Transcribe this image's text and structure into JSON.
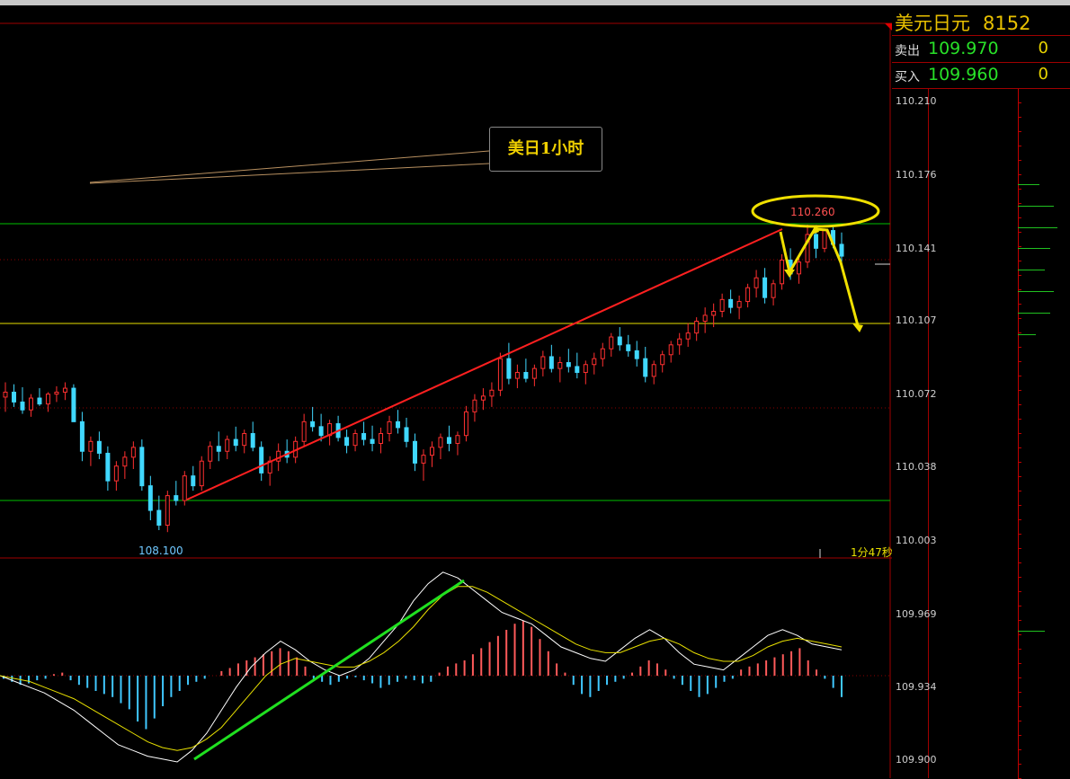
{
  "panel": {
    "title": "美元日元",
    "code": "8152",
    "sell_label": "卖出",
    "sell_price": "109.970",
    "sell_qty": "0",
    "buy_label": "买入",
    "buy_price": "109.960",
    "buy_qty": "0"
  },
  "annotation": {
    "callout": "美日1小时",
    "peak_label": "110.260",
    "low_label": "108.100",
    "timer": "1分47秒"
  },
  "colors": {
    "up": "#ff3030",
    "down": "#40d8ff",
    "trend_up": "#ff2020",
    "trend_macd": "#20e020",
    "ellipse": "#f0e000",
    "support": "#00c000",
    "midline": "#e8e000"
  },
  "chart_data": {
    "type": "candlestick",
    "instrument": "USDJPY 1H",
    "yticks": [
      "110.210",
      "110.176",
      "110.141",
      "110.107",
      "110.072",
      "110.038",
      "110.003",
      "109.969",
      "109.934",
      "109.900"
    ],
    "ohlc": [
      [
        110.085,
        110.1,
        110.07,
        110.09
      ],
      [
        110.09,
        110.098,
        110.075,
        110.08
      ],
      [
        110.08,
        110.095,
        110.068,
        110.072
      ],
      [
        110.072,
        110.088,
        110.065,
        110.084
      ],
      [
        110.084,
        110.094,
        110.076,
        110.078
      ],
      [
        110.078,
        110.09,
        110.07,
        110.088
      ],
      [
        110.088,
        110.096,
        110.08,
        110.09
      ],
      [
        110.09,
        110.1,
        110.082,
        110.094
      ],
      [
        110.094,
        110.098,
        110.06,
        110.06
      ],
      [
        110.06,
        110.07,
        110.02,
        110.03
      ],
      [
        110.03,
        110.045,
        110.015,
        110.04
      ],
      [
        110.04,
        110.05,
        110.022,
        110.028
      ],
      [
        110.028,
        110.035,
        109.99,
        110.0
      ],
      [
        110.0,
        110.02,
        109.99,
        110.015
      ],
      [
        110.015,
        110.03,
        110.002,
        110.024
      ],
      [
        110.024,
        110.04,
        110.012,
        110.034
      ],
      [
        110.034,
        110.042,
        109.99,
        109.995
      ],
      [
        109.995,
        110.005,
        109.96,
        109.97
      ],
      [
        109.97,
        109.985,
        109.95,
        109.955
      ],
      [
        109.955,
        109.99,
        109.948,
        109.985
      ],
      [
        109.985,
        110.0,
        109.975,
        109.98
      ],
      [
        109.98,
        110.01,
        109.975,
        110.005
      ],
      [
        110.005,
        110.015,
        109.99,
        109.995
      ],
      [
        109.995,
        110.025,
        109.99,
        110.02
      ],
      [
        110.02,
        110.04,
        110.012,
        110.035
      ],
      [
        110.035,
        110.05,
        110.02,
        110.03
      ],
      [
        110.03,
        110.046,
        110.022,
        110.042
      ],
      [
        110.042,
        110.055,
        110.03,
        110.036
      ],
      [
        110.036,
        110.052,
        110.028,
        110.048
      ],
      [
        110.048,
        110.06,
        110.03,
        110.034
      ],
      [
        110.034,
        110.04,
        110.0,
        110.008
      ],
      [
        110.008,
        110.025,
        109.995,
        110.02
      ],
      [
        110.02,
        110.038,
        110.01,
        110.03
      ],
      [
        110.03,
        110.042,
        110.018,
        110.024
      ],
      [
        110.024,
        110.045,
        110.018,
        110.04
      ],
      [
        110.04,
        110.068,
        110.035,
        110.06
      ],
      [
        110.06,
        110.075,
        110.05,
        110.055
      ],
      [
        110.055,
        110.068,
        110.04,
        110.046
      ],
      [
        110.046,
        110.062,
        110.036,
        110.058
      ],
      [
        110.058,
        110.066,
        110.04,
        110.044
      ],
      [
        110.044,
        110.052,
        110.028,
        110.036
      ],
      [
        110.036,
        110.052,
        110.03,
        110.048
      ],
      [
        110.048,
        110.06,
        110.036,
        110.042
      ],
      [
        110.042,
        110.056,
        110.03,
        110.038
      ],
      [
        110.038,
        110.054,
        110.028,
        110.048
      ],
      [
        110.048,
        110.066,
        110.04,
        110.06
      ],
      [
        110.06,
        110.072,
        110.048,
        110.054
      ],
      [
        110.054,
        110.064,
        110.034,
        110.04
      ],
      [
        110.04,
        110.048,
        110.01,
        110.018
      ],
      [
        110.018,
        110.032,
        110.0,
        110.026
      ],
      [
        110.026,
        110.04,
        110.014,
        110.034
      ],
      [
        110.034,
        110.048,
        110.022,
        110.044
      ],
      [
        110.044,
        110.056,
        110.03,
        110.038
      ],
      [
        110.038,
        110.05,
        110.026,
        110.046
      ],
      [
        110.046,
        110.076,
        110.04,
        110.07
      ],
      [
        110.07,
        110.088,
        110.06,
        110.082
      ],
      [
        110.082,
        110.094,
        110.072,
        110.086
      ],
      [
        110.086,
        110.1,
        110.075,
        110.092
      ],
      [
        110.092,
        110.13,
        110.086,
        110.124
      ],
      [
        110.124,
        110.14,
        110.098,
        110.104
      ],
      [
        110.104,
        110.118,
        110.094,
        110.11
      ],
      [
        110.11,
        110.124,
        110.1,
        110.104
      ],
      [
        110.104,
        110.118,
        110.096,
        110.114
      ],
      [
        110.114,
        110.132,
        110.106,
        110.126
      ],
      [
        110.126,
        110.138,
        110.11,
        110.114
      ],
      [
        110.114,
        110.126,
        110.1,
        110.12
      ],
      [
        110.12,
        110.134,
        110.11,
        110.116
      ],
      [
        110.116,
        110.13,
        110.104,
        110.11
      ],
      [
        110.11,
        110.122,
        110.098,
        110.118
      ],
      [
        110.118,
        110.13,
        110.108,
        110.124
      ],
      [
        110.124,
        110.14,
        110.116,
        110.134
      ],
      [
        110.134,
        110.15,
        110.126,
        110.146
      ],
      [
        110.146,
        110.156,
        110.132,
        110.138
      ],
      [
        110.138,
        110.148,
        110.126,
        110.132
      ],
      [
        110.132,
        110.142,
        110.116,
        110.124
      ],
      [
        110.124,
        110.136,
        110.1,
        110.106
      ],
      [
        110.106,
        110.122,
        110.098,
        110.118
      ],
      [
        110.118,
        110.132,
        110.11,
        110.128
      ],
      [
        110.128,
        110.142,
        110.12,
        110.138
      ],
      [
        110.138,
        110.15,
        110.128,
        110.144
      ],
      [
        110.144,
        110.16,
        110.136,
        110.15
      ],
      [
        110.15,
        110.166,
        110.142,
        110.162
      ],
      [
        110.162,
        110.176,
        110.15,
        110.168
      ],
      [
        110.168,
        110.18,
        110.156,
        110.172
      ],
      [
        110.172,
        110.19,
        110.166,
        110.184
      ],
      [
        110.184,
        110.194,
        110.17,
        110.176
      ],
      [
        110.176,
        110.188,
        110.164,
        110.182
      ],
      [
        110.182,
        110.2,
        110.176,
        110.196
      ],
      [
        110.196,
        110.214,
        110.186,
        110.206
      ],
      [
        110.206,
        110.216,
        110.18,
        110.186
      ],
      [
        110.186,
        110.204,
        110.178,
        110.2
      ],
      [
        110.2,
        110.23,
        110.194,
        110.224
      ],
      [
        110.224,
        110.236,
        110.204,
        110.21
      ],
      [
        110.21,
        110.228,
        110.2,
        110.222
      ],
      [
        110.222,
        110.26,
        110.216,
        110.25
      ],
      [
        110.25,
        110.258,
        110.226,
        110.236
      ],
      [
        110.236,
        110.256,
        110.232,
        110.254
      ],
      [
        110.254,
        110.258,
        110.236,
        110.24
      ],
      [
        110.24,
        110.252,
        110.222,
        110.228
      ]
    ],
    "macd_hist": [
      -2,
      -4,
      -6,
      -5,
      -3,
      -2,
      1,
      2,
      -3,
      -6,
      -8,
      -10,
      -12,
      -14,
      -18,
      -22,
      -30,
      -35,
      -28,
      -20,
      -14,
      -10,
      -6,
      -4,
      -2,
      0,
      3,
      5,
      8,
      10,
      12,
      14,
      16,
      18,
      16,
      12,
      6,
      -2,
      -4,
      -6,
      -4,
      -2,
      -1,
      -3,
      -5,
      -8,
      -6,
      -4,
      -2,
      -3,
      -5,
      -4,
      2,
      6,
      8,
      10,
      14,
      18,
      22,
      26,
      30,
      34,
      36,
      32,
      24,
      16,
      8,
      2,
      -6,
      -12,
      -14,
      -10,
      -6,
      -4,
      -2,
      2,
      6,
      10,
      8,
      4,
      -2,
      -6,
      -10,
      -14,
      -12,
      -8,
      -4,
      -2,
      4,
      6,
      8,
      10,
      12,
      14,
      16,
      18,
      10,
      4,
      -2,
      -8,
      -14
    ],
    "macd_dif": [
      0.0,
      -0.2,
      -0.4,
      -0.6,
      -0.9,
      -1.2,
      -1.6,
      -2.0,
      -2.4,
      -2.6,
      -2.8,
      -2.9,
      -3.0,
      -2.6,
      -2.0,
      -1.2,
      -0.4,
      0.3,
      0.8,
      1.2,
      0.9,
      0.5,
      0.2,
      0.0,
      0.2,
      0.6,
      1.2,
      1.8,
      2.6,
      3.2,
      3.6,
      3.4,
      3.0,
      2.6,
      2.2,
      2.0,
      1.8,
      1.4,
      1.0,
      0.8,
      0.6,
      0.5,
      0.9,
      1.3,
      1.6,
      1.3,
      0.8,
      0.4,
      0.3,
      0.2,
      0.6,
      1.0,
      1.4,
      1.6,
      1.4,
      1.1,
      1.0,
      0.9
    ],
    "macd_dea": [
      0.0,
      -0.1,
      -0.2,
      -0.4,
      -0.6,
      -0.8,
      -1.1,
      -1.4,
      -1.7,
      -2.0,
      -2.3,
      -2.5,
      -2.6,
      -2.5,
      -2.2,
      -1.8,
      -1.2,
      -0.6,
      0.0,
      0.4,
      0.6,
      0.5,
      0.4,
      0.3,
      0.3,
      0.5,
      0.8,
      1.2,
      1.7,
      2.3,
      2.8,
      3.1,
      3.1,
      2.9,
      2.6,
      2.3,
      2.0,
      1.7,
      1.4,
      1.1,
      0.9,
      0.8,
      0.8,
      1.0,
      1.2,
      1.3,
      1.1,
      0.8,
      0.6,
      0.5,
      0.5,
      0.7,
      1.0,
      1.2,
      1.3,
      1.2,
      1.1,
      1.0
    ]
  }
}
